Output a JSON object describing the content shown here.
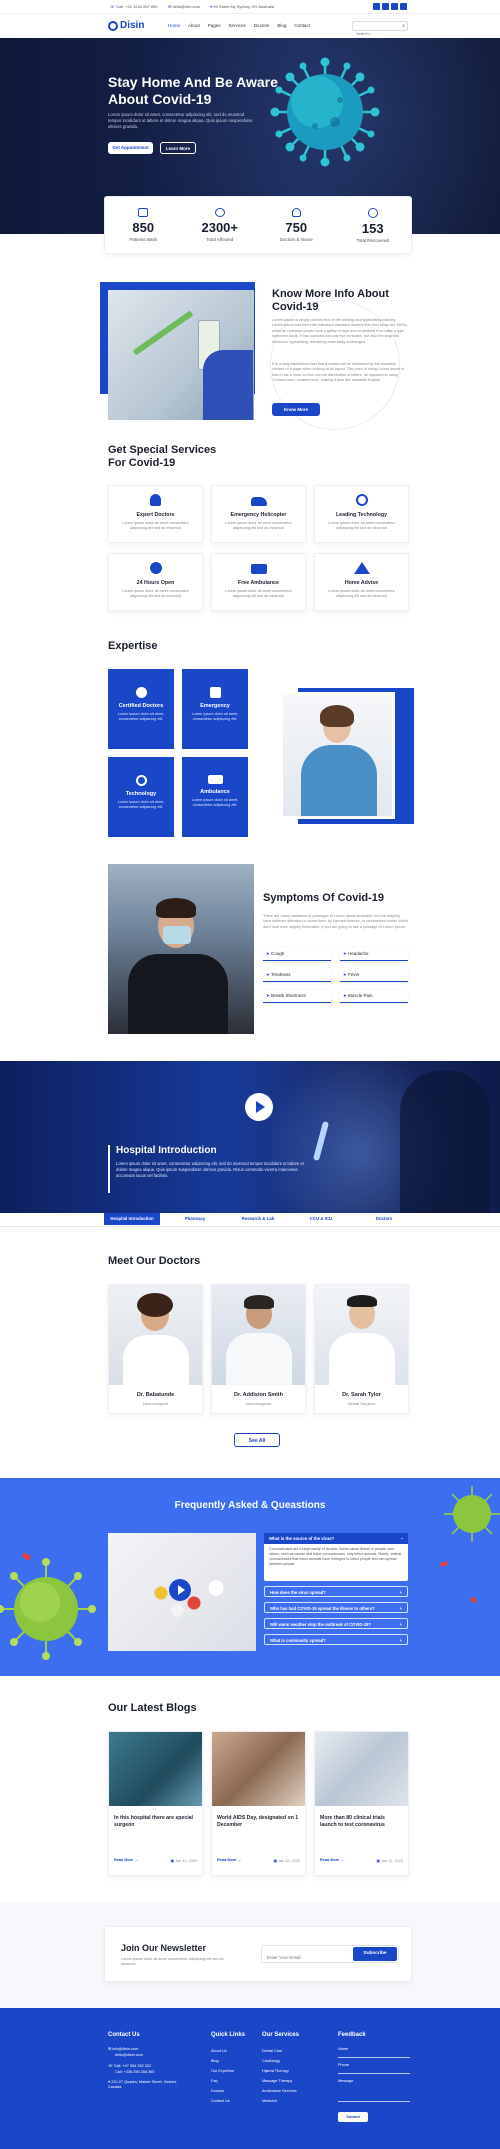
{
  "topbar": {
    "phone": "Call: +01 1234 567 890",
    "email": "hello@info.com",
    "location": "50 Street Ny Sydney, NY Australia",
    "socials": [
      "facebook-icon",
      "twitter-icon",
      "linkedin-icon",
      "instagram-icon"
    ]
  },
  "nav": {
    "logo": "Disin",
    "items": [
      "Home",
      "About",
      "Pages",
      "Services",
      "Doctors",
      "Blog",
      "Contact"
    ],
    "search_placeholder": "Search..."
  },
  "hero": {
    "title_line1": "Stay Home And Be Aware",
    "title_line2": "About Covid-19",
    "text": "Lorem ipsum dolor sit amet, consectetur adipiscing elit, sed do eiusmod tempor incididunt ut labore et dolore magna aliqua. Quis ipsum suspendisse ultrices gravida.",
    "btn_primary": "Get Appointment",
    "btn_secondary": "Learn More"
  },
  "stats": [
    {
      "value": "850",
      "label": "Patients Beds"
    },
    {
      "value": "2300+",
      "label": "Total Affected"
    },
    {
      "value": "750",
      "label": "Doctors & Nurse"
    },
    {
      "value": "153",
      "label": "Total Recovered"
    }
  ],
  "about": {
    "title_line1": "Know More Info About",
    "title_line2": "Covid-19",
    "text1": "Lorem ipsum is simply dummy text of the printing and typesetting industry. Lorem ipsum has been the industry's standard dummy text ever since the 1500s, when an unknown printer took a galley of type and scrambled it to make a type specimen book. It has survived not only five centuries, but also the leap into electronic typesetting, remaining essentially unchanged.",
    "text2": "It is a long established fact that a reader will be distracted by the readable content of a page when looking at its layout. The point of using Lorem Ipsum is that it has a more-or-less normal distribution of letters, as opposed to using 'Content here, content here', making it look like readable English.",
    "button": "Know More"
  },
  "services": {
    "title_line1": "Get Special Services",
    "title_line2": "For Covid-19",
    "items": [
      {
        "title": "Expert Doctors",
        "text": "Lorem ipsum dolor sit amet consectetur adipiscing elit sed do eiusmod",
        "icon": "doctor-icon"
      },
      {
        "title": "Emergency Helicopter",
        "text": "Lorem ipsum dolor sit amet consectetur adipiscing elit sed do eiusmod",
        "icon": "helicopter-icon"
      },
      {
        "title": "Leading Technology",
        "text": "Lorem ipsum dolor sit amet consectetur adipiscing elit sed do eiusmod",
        "icon": "technology-icon"
      },
      {
        "title": "24 Hours Open",
        "text": "Lorem ipsum dolor sit amet consectetur adipiscing elit sed do eiusmod",
        "icon": "clock-icon"
      },
      {
        "title": "Free Ambulance",
        "text": "Lorem ipsum dolor sit amet consectetur adipiscing elit sed do eiusmod",
        "icon": "ambulance-icon"
      },
      {
        "title": "Home Advise",
        "text": "Lorem ipsum dolor sit amet consectetur adipiscing elit sed do eiusmod",
        "icon": "home-icon"
      }
    ]
  },
  "expertise": {
    "title": "Expertise",
    "items": [
      {
        "title": "Certified Doctors",
        "text": "Lorem ipsum dolor sit amet, consectetur adipiscing elit."
      },
      {
        "title": "Emergency",
        "text": "Lorem ipsum dolor sit amet, consectetur adipiscing elit."
      },
      {
        "title": "Technology",
        "text": "Lorem ipsum dolor sit amet, consectetur adipiscing elit."
      },
      {
        "title": "Ambulance",
        "text": "Lorem ipsum dolor sit amet, consectetur adipiscing elit."
      }
    ]
  },
  "symptoms": {
    "title": "Symptoms Of Covid-19",
    "text": "There are many variations of passages of Lorem Ipsum available, but the majority have suffered alteration in some form, by injected humour, or randomised words which don't look even slightly believable. If you are going to use a passage of Lorem Ipsum.",
    "items": [
      "Cough",
      "Headache",
      "Tiredness",
      "Fever",
      "Breath Shortness",
      "Muscle Pain"
    ]
  },
  "video": {
    "title": "Hospital Introduction",
    "text": "Lorem ipsum dolor sit amet, consectetur adipiscing elit, sed do eiusmod tempor incididunt ut labore et dolore magna aliqua. Quis ipsum suspendisse ultrices gravida. Risus commodo viverra maecenas accumsan lacus vel facilisis.",
    "tabs": [
      "Hospital Introduction",
      "Pharmacy",
      "Research & Lab",
      "CCU & ICU",
      "Doctors"
    ]
  },
  "doctors": {
    "title": "Meet Our Doctors",
    "items": [
      {
        "name": "Dr. Babatunde",
        "role": "Neurosurgeon"
      },
      {
        "name": "Dr. Addision Smith",
        "role": "Neurosurgeon"
      },
      {
        "name": "Dr. Sarah Tylor",
        "role": "Dental Surgeon"
      }
    ],
    "button": "See All"
  },
  "faq": {
    "title": "Frequently Asked & Queastions",
    "active_q": "What is the source of the virus?",
    "active_a": "Coronaviruses are a large family of viruses. Some cause illness in people, and others, such as canine and feline coronaviruses, only infect animals. Rarely, animal coronaviruses that infect animals have emerged to infect people and can spread between people.",
    "questions": [
      "How does the virus spread?",
      "Who has had COVID-19 spread the illness to others?",
      "Will warm weather stop the outbreak of COVID-19?",
      "What is community spread?"
    ]
  },
  "blogs": {
    "title": "Our Latest Blogs",
    "items": [
      {
        "title": "In this hospital there are special surgeon",
        "date": "Jan 12, 2020"
      },
      {
        "title": "World AIDS Day, designated on 1 December",
        "date": "Jan 12, 2020"
      },
      {
        "title": "More than 80 clinical trials launch to test coronavirus",
        "date": "Jan 12, 2020"
      }
    ],
    "read_more": "Read More"
  },
  "newsletter": {
    "title": "Join Our Newsletter",
    "text": "Lorem ipsum dolor sit amet consectetur adipiscing elit sed do eiusmod.",
    "placeholder": "Enter Your Email",
    "button": "Subscribe"
  },
  "footer": {
    "contact_title": "Contact Us",
    "contact_items": [
      "info@disin.com",
      "hello@disin.com",
      "Call: +07 554 332 322",
      "Call: +236 256 256 365",
      "210-27 Quadra, Market Street, Victoria Canada"
    ],
    "links_title": "Quick Links",
    "links": [
      "About Us",
      "Blog",
      "Our Expertise",
      "Faq",
      "Doctors",
      "Contact Us"
    ],
    "services_title": "Our Services",
    "services": [
      "Dental Care",
      "Cardiology",
      "Hijama Therapy",
      "Massage Therapy",
      "Ambluance Services",
      "Medicine"
    ],
    "feedback_title": "Feedback",
    "feedback_fields": [
      "Name",
      "Phone",
      "Message"
    ],
    "feedback_button": "Submit"
  },
  "colors": {
    "primary": "#1a46c8",
    "dark": "#0d1836",
    "faq_bg": "#3d6ef0",
    "virus": "#2ec4d6"
  }
}
